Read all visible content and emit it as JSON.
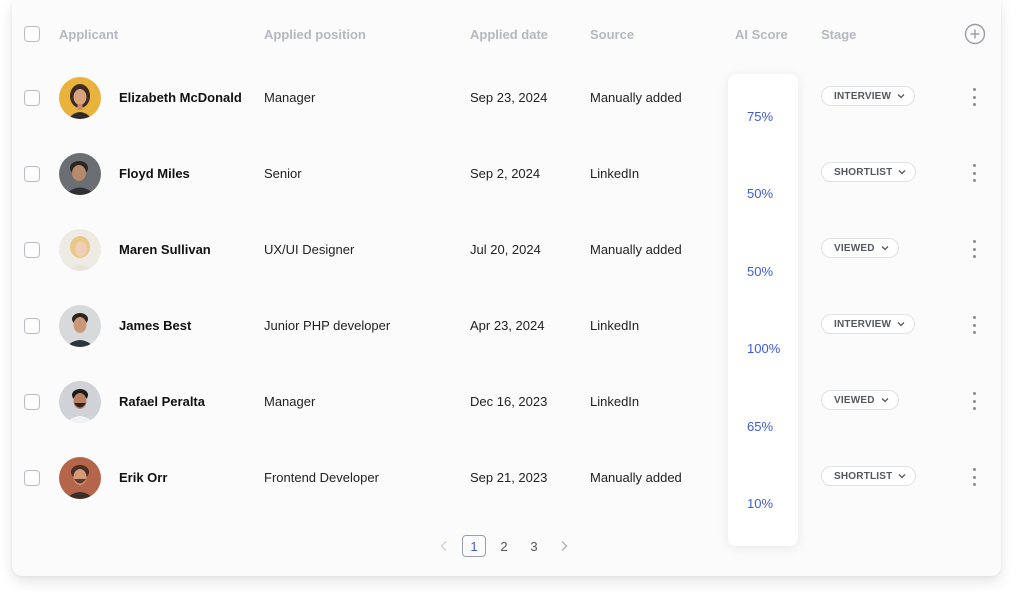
{
  "header": {
    "applicant": "Applicant",
    "position": "Applied position",
    "date": "Applied date",
    "source": "Source",
    "ai_score": "AI Score",
    "stage": "Stage"
  },
  "icons": {
    "add_column": "plus-circle-icon",
    "stage_dropdown": "chevron-down-icon",
    "row_menu": "more-vertical-icon",
    "prev": "chevron-left-icon",
    "next": "chevron-right-icon"
  },
  "rows": [
    {
      "name": "Elizabeth McDonald",
      "position": "Manager",
      "date": "Sep 23, 2024",
      "source": "Manually added",
      "score": "75%",
      "stage": "INTERVIEW"
    },
    {
      "name": "Floyd Miles",
      "position": "Senior",
      "date": "Sep 2, 2024",
      "source": "LinkedIn",
      "score": "50%",
      "stage": "SHORTLIST"
    },
    {
      "name": "Maren Sullivan",
      "position": "UX/UI Designer",
      "date": "Jul 20, 2024",
      "source": "Manually added",
      "score": "50%",
      "stage": "VIEWED"
    },
    {
      "name": "James Best",
      "position": "Junior PHP developer",
      "date": "Apr 23, 2024",
      "source": "LinkedIn",
      "score": "100%",
      "stage": "INTERVIEW"
    },
    {
      "name": "Rafael Peralta",
      "position": "Manager",
      "date": "Dec 16, 2023",
      "source": "LinkedIn",
      "score": "65%",
      "stage": "VIEWED"
    },
    {
      "name": "Erik Orr",
      "position": "Frontend Developer",
      "date": "Sep 21, 2023",
      "source": "Manually added",
      "score": "10%",
      "stage": "SHORTLIST"
    }
  ],
  "pagination": {
    "pages": [
      "1",
      "2",
      "3"
    ],
    "current": "1"
  },
  "colors": {
    "accent": "#3b5bdb",
    "header_text": "#b5b8bf"
  }
}
